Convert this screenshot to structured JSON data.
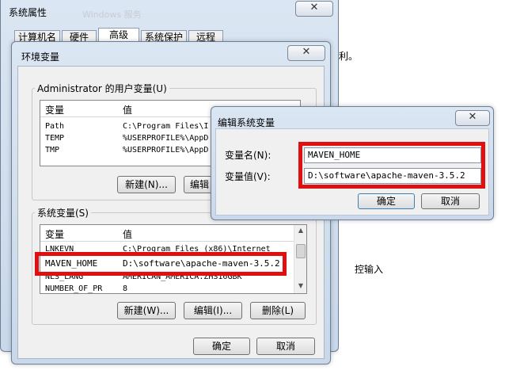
{
  "sysprops": {
    "title": "系统属性",
    "close": "✕",
    "bg_title": "Windows 服务",
    "tabs": [
      "计算机名",
      "硬件",
      "高级",
      "系统保护",
      "远程"
    ],
    "bg_text_right1": "利。",
    "bg_text_right2": "控输入"
  },
  "envvars": {
    "title": "环境变量",
    "close": "✕",
    "user_group_label": "Administrator 的用户变量(U)",
    "col_var": "变量",
    "col_val": "值",
    "user_rows": [
      {
        "name": "Path",
        "value": "C:\\Program Files\\I"
      },
      {
        "name": "TEMP",
        "value": "%USERPROFILE%\\AppD"
      },
      {
        "name": "TMP",
        "value": "%USERPROFILE%\\AppD"
      }
    ],
    "user_new": "新建(N)...",
    "user_edit": "编辑",
    "sys_group_label": "系统变量(S)",
    "sys_rows": [
      {
        "name": "LNKEVN",
        "value": "C:\\Program Files (x86)\\Internet"
      },
      {
        "name": "MAVEN_HOME",
        "value": "D:\\software\\apache-maven-3.5.2"
      },
      {
        "name": "NLS_LANG",
        "value": "AMERICAN_AMERICA.ZHS16GBK"
      },
      {
        "name": "NUMBER_OF_PR",
        "value": "8"
      }
    ],
    "sys_new": "新建(W)...",
    "sys_edit": "编辑(I)...",
    "sys_delete": "删除(L)",
    "ok": "确定",
    "cancel": "取消"
  },
  "editdlg": {
    "title": "编辑系统变量",
    "close": "✕",
    "name_label": "变量名(N):",
    "value_label": "变量值(V):",
    "name_value": "MAVEN_HOME",
    "value_value": "D:\\software\\apache-maven-3.5.2",
    "ok": "确定",
    "cancel": "取消"
  },
  "colors": {
    "highlight": "#e01010",
    "window_frame": "#c9d8ea"
  }
}
